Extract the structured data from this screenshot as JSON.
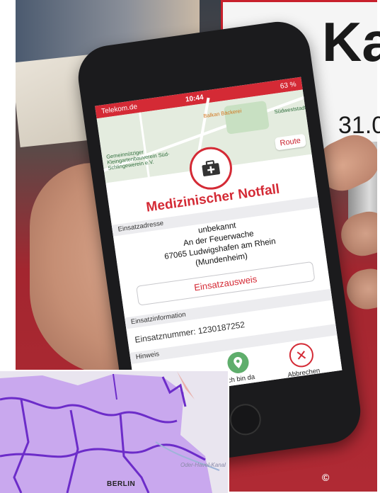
{
  "phone": {
    "status_bar": {
      "carrier": "Telekom.de",
      "time": "10:44",
      "battery": "63 %"
    },
    "map_labels": [
      "Gemeinnütziger Kleingartenbauverein Süd-Schlingewerein e.V.",
      "Balkan Bäckerei",
      "Südweststadt"
    ],
    "route_button": "Route",
    "title": "Medizinischer Notfall",
    "address_label": "Einsatzadresse",
    "address_lines": [
      "unbekannt",
      "An der Feuerwache",
      "67065 Ludwigshafen am Rhein",
      "(Mundenheim)"
    ],
    "ausweis_button": "Einsatzausweis",
    "info_label": "Einsatzinformation",
    "einsatznummer": "Einsatznummer: 1230187252",
    "hint_label": "Hinweis",
    "arrived_button": "Ich bin da",
    "cancel_button": "Abbrechen",
    "icons": [
      "medical-bag-icon",
      "location-pin-icon",
      "close-icon",
      "wifi-icon",
      "location-arrow-icon",
      "battery-icon"
    ]
  },
  "banner": {
    "text": "Ka",
    "date_fragment": "31.0"
  },
  "map_inset": {
    "city_label": "BERLIN",
    "river_label": "Oder-Havel-Kanal"
  },
  "copyright": "©",
  "colors": {
    "accent_red": "#d42a35",
    "confirm_green": "#5fae6c",
    "region_purple": "#b28be6",
    "border_purple": "#6c2cc9"
  }
}
